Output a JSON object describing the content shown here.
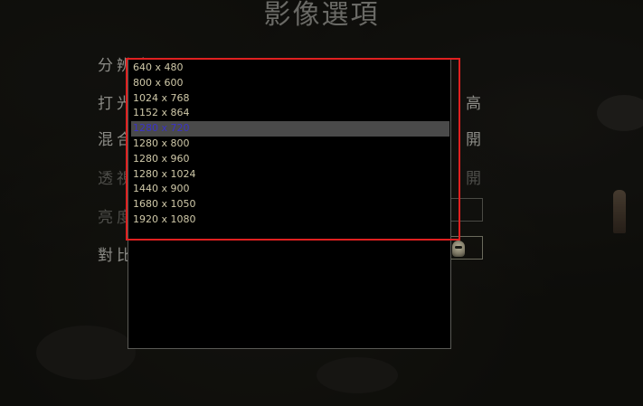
{
  "window": {
    "title": "影像選項"
  },
  "options": [
    {
      "label": "分辨率",
      "value": "",
      "faded": false
    },
    {
      "label": "打光品質",
      "value": "高",
      "faded": false
    },
    {
      "label": "混合陰影",
      "value": "開",
      "faded": false
    },
    {
      "label": "透視",
      "value": "開",
      "faded": true
    },
    {
      "label": "亮度",
      "value": "",
      "faded": true
    },
    {
      "label": "對比",
      "value": "",
      "faded": false
    }
  ],
  "resolution_dropdown": {
    "selected": "1280 x 720",
    "items": [
      "640 x 480",
      "800 x 600",
      "1024 x 768",
      "1152 x 864",
      "1280 x 720",
      "1280 x 800",
      "1280 x 960",
      "1280 x 1024",
      "1440 x 900",
      "1680 x 1050",
      "1920 x 1080"
    ]
  },
  "colors": {
    "highlight_frame": "#e02020",
    "selected_item_bg": "#4a4a4a",
    "selected_item_text": "#3a32c8",
    "item_text": "#cfc8a8",
    "label_text": "#8b8b86"
  },
  "icons": {
    "slider_thumb": "skull-icon"
  }
}
